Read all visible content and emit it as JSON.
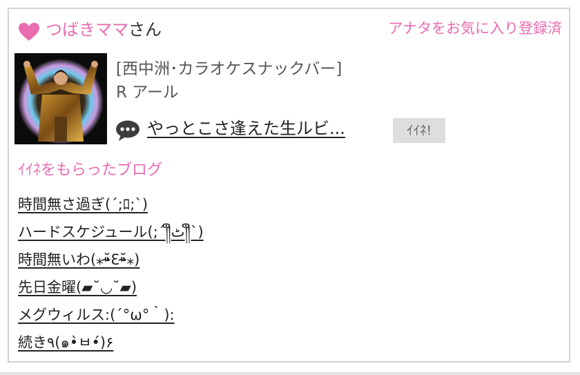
{
  "header": {
    "user_name": "つばきママ",
    "user_suffix": "さん",
    "favorite_status": "アナタをお気に入り登録済"
  },
  "shop": {
    "genre": "[西中洲･カラオケスナックバー]",
    "name": "R アール"
  },
  "comment": {
    "text": "やっとこさ逢えた生ルビ...",
    "iine_label": "ｲｲﾈ!"
  },
  "liked_blogs": {
    "title": "ｲｲﾈをもらったブログ",
    "items": [
      "時間無さ過ぎ(´;ﾛ;`)",
      "ハードスケジュール(;´༎ຶٹ༎ຶ`)",
      "時間無いわ(⁎⁍̴̆Ɛ⁍̴̆⁎)",
      "先日金曜(▰˘◡˘▰)",
      "メグウィルス:(´°ω°｀):",
      "続き٩(๑•̀ㅂ•́)۶"
    ]
  },
  "colors": {
    "accent_pink": "#e96bb0",
    "button_gray": "#dedede",
    "border_gray": "#d2d2d2"
  },
  "icons": [
    "heart-icon",
    "speech-bubble-icon"
  ]
}
